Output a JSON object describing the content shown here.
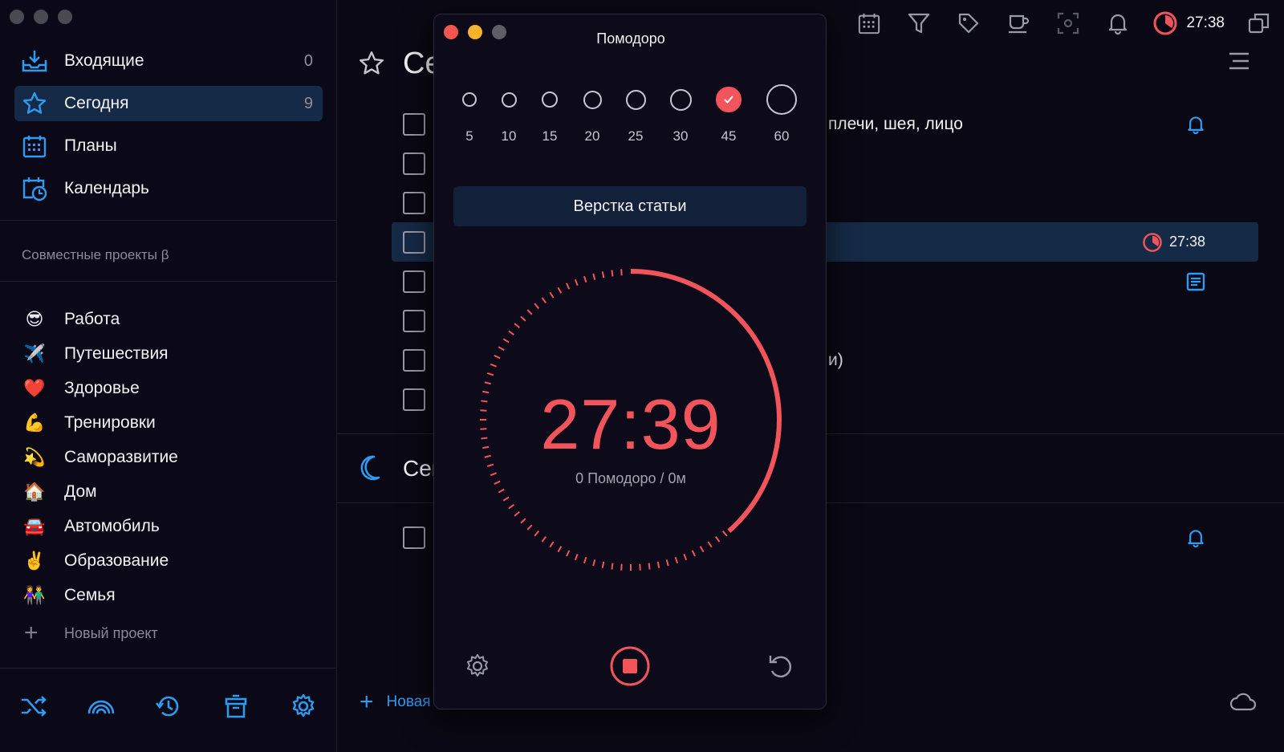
{
  "sidebar": {
    "nav": [
      {
        "label": "Входящие",
        "count": "0",
        "icon": "inbox-icon"
      },
      {
        "label": "Сегодня",
        "count": "9",
        "icon": "star-icon"
      },
      {
        "label": "Планы",
        "count": "",
        "icon": "calendar-grid-icon"
      },
      {
        "label": "Календарь",
        "count": "",
        "icon": "calendar-clock-icon"
      }
    ],
    "shared_title": "Совместные проекты β",
    "projects": [
      {
        "emoji": "😎",
        "label": "Работа"
      },
      {
        "emoji": "✈️",
        "label": "Путешествия"
      },
      {
        "emoji": "❤️",
        "label": "Здоровье"
      },
      {
        "emoji": "💪",
        "label": "Тренировки"
      },
      {
        "emoji": "💫",
        "label": "Саморазвитие"
      },
      {
        "emoji": "🏠",
        "label": "Дом"
      },
      {
        "emoji": "🚘",
        "label": "Автомобиль"
      },
      {
        "emoji": "✌️",
        "label": "Образование"
      },
      {
        "emoji": "👫",
        "label": "Семья"
      }
    ],
    "new_project": "Новый проект"
  },
  "topbar": {
    "timer": "27:38"
  },
  "main": {
    "title": "Се",
    "section2_title": "Сег",
    "tasks": [
      {
        "text": "плечи, шея, лицо"
      },
      {
        "text": ""
      },
      {
        "text": ""
      },
      {
        "text": "",
        "timer": "27:38"
      },
      {
        "text": ""
      },
      {
        "text": ""
      },
      {
        "text": "и)"
      },
      {
        "text": ""
      }
    ],
    "add_task": "Новая з"
  },
  "pomodoro": {
    "title": "Помодоро",
    "durations": [
      "5",
      "10",
      "15",
      "20",
      "25",
      "30",
      "45",
      "60"
    ],
    "selected_duration": "45",
    "task_name": "Верстка статьи",
    "time": "27:39",
    "summary": "0 Помодоро / 0м",
    "progress_fraction": 0.385
  },
  "colors": {
    "accent_red": "#f2545b",
    "accent_blue": "#2e9bf0",
    "active_row": "#152a47"
  }
}
